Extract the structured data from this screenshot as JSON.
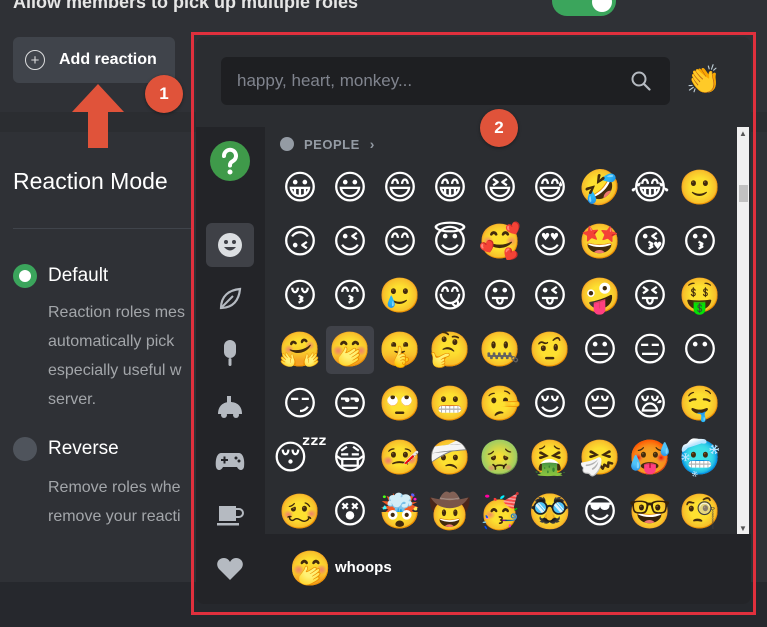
{
  "settings": {
    "allow_multiple_label": "Allow members to pick up multiple roles",
    "add_reaction_label": "Add reaction",
    "mode_title": "Reaction Mode",
    "options": [
      {
        "label": "Default",
        "selected": true,
        "desc": [
          "Reaction roles mes",
          "automatically pick",
          "especially useful w",
          "server."
        ]
      },
      {
        "label": "Reverse",
        "selected": false,
        "desc": [
          "Remove roles whe",
          "remove your reacti"
        ]
      }
    ]
  },
  "annotations": {
    "badge1": "1",
    "badge2": "2",
    "accent": "#e0533a",
    "frame_color": "#e0303d"
  },
  "picker": {
    "search_placeholder": "happy, heart, monkey...",
    "diversity_emoji": "👏",
    "section_label": "PEOPLE",
    "categories": [
      "server-icon",
      "people-icon",
      "nature-icon",
      "food-icon",
      "activities-icon",
      "gaming-icon",
      "objects-icon",
      "symbols-icon"
    ],
    "rows": [
      [
        "😀",
        "😃",
        "😄",
        "😁",
        "😆",
        "😅",
        "🤣",
        "😂",
        "🙂"
      ],
      [
        "🙃",
        "😉",
        "😊",
        "😇",
        "🥰",
        "😍",
        "🤩",
        "😘",
        "😗"
      ],
      [
        "😚",
        "😙",
        "🥲",
        "😋",
        "😛",
        "😜",
        "🤪",
        "😝",
        "🤑"
      ],
      [
        "🤗",
        "🤭",
        "🤫",
        "🤔",
        "🤐",
        "🤨",
        "😐",
        "😑",
        "😶"
      ],
      [
        "😏",
        "😒",
        "🙄",
        "😬",
        "🤥",
        "😌",
        "😔",
        "😪",
        "🤤"
      ],
      [
        "😴",
        "😷",
        "🤒",
        "🤕",
        "🤢",
        "🤮",
        "🤧",
        "🥵",
        "🥶"
      ],
      [
        "🥴",
        "😵",
        "🤯",
        "🤠",
        "🥳",
        "🥸",
        "😎",
        "🤓",
        "🧐"
      ]
    ],
    "hovered": {
      "emoji": "🤭",
      "name": "whoops"
    }
  }
}
